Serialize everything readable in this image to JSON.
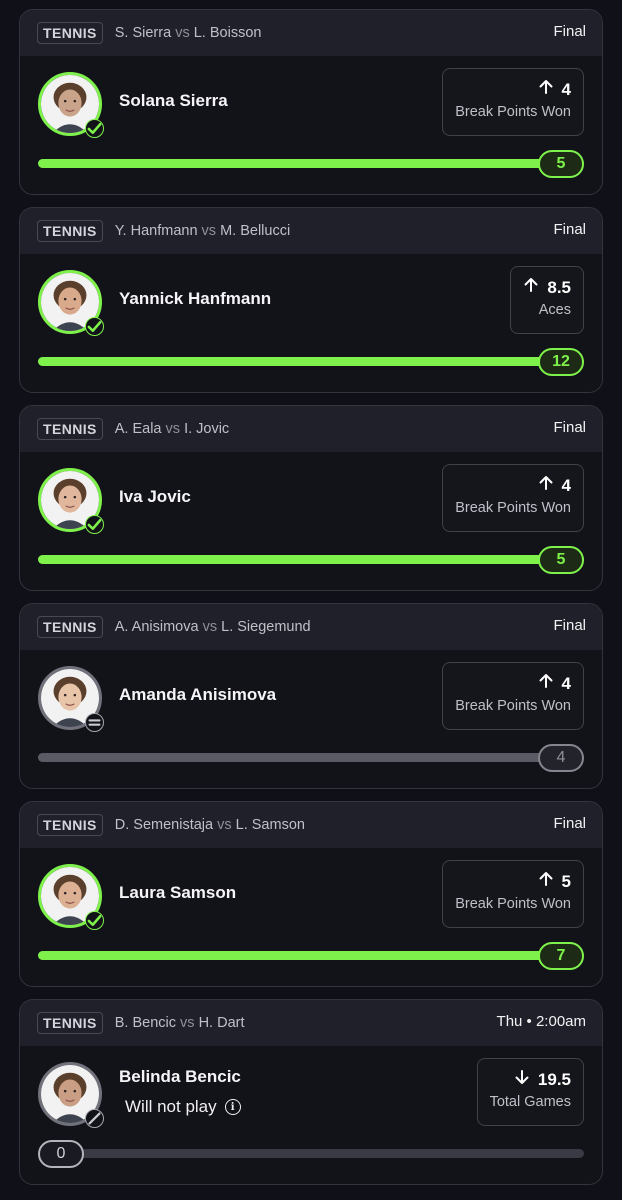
{
  "colors": {
    "background": "#101018",
    "card": "#121219",
    "card_header": "#1f2029",
    "accent_green": "#7ef14a",
    "neutral_grey": "#5a5b65",
    "text_muted": "#bfc0c8"
  },
  "cards": [
    {
      "sport": "TENNIS",
      "player_a": "S. Sierra",
      "vs": "vs",
      "player_b": "L. Boisson",
      "status": "Final",
      "name": "Solana Sierra",
      "subtext": "",
      "direction": "up",
      "direction_icon": "arrow-up-icon",
      "line": "4",
      "stat": "Break Points Won",
      "result": "5",
      "progress": 1.0,
      "state": "won",
      "badge_icon": "check-icon",
      "avatar_tone": "#c9a48a"
    },
    {
      "sport": "TENNIS",
      "player_a": "Y. Hanfmann",
      "vs": "vs",
      "player_b": "M. Bellucci",
      "status": "Final",
      "name": "Yannick Hanfmann",
      "subtext": "",
      "direction": "up",
      "direction_icon": "arrow-up-icon",
      "line": "8.5",
      "stat": "Aces",
      "result": "12",
      "progress": 1.0,
      "state": "won",
      "badge_icon": "check-icon",
      "avatar_tone": "#d9a98c"
    },
    {
      "sport": "TENNIS",
      "player_a": "A. Eala",
      "vs": "vs",
      "player_b": "I. Jovic",
      "status": "Final",
      "name": "Iva Jovic",
      "subtext": "",
      "direction": "up",
      "direction_icon": "arrow-up-icon",
      "line": "4",
      "stat": "Break Points Won",
      "result": "5",
      "progress": 1.0,
      "state": "won",
      "badge_icon": "check-icon",
      "avatar_tone": "#e0b79d"
    },
    {
      "sport": "TENNIS",
      "player_a": "A. Anisimova",
      "vs": "vs",
      "player_b": "L. Siegemund",
      "status": "Final",
      "name": "Amanda Anisimova",
      "subtext": "",
      "direction": "up",
      "direction_icon": "arrow-up-icon",
      "line": "4",
      "stat": "Break Points Won",
      "result": "4",
      "progress": 1.0,
      "state": "push",
      "badge_icon": "equals-icon",
      "avatar_tone": "#e8c4a8"
    },
    {
      "sport": "TENNIS",
      "player_a": "D. Semenistaja",
      "vs": "vs",
      "player_b": "L. Samson",
      "status": "Final",
      "name": "Laura Samson",
      "subtext": "",
      "direction": "up",
      "direction_icon": "arrow-up-icon",
      "line": "5",
      "stat": "Break Points Won",
      "result": "7",
      "progress": 1.0,
      "state": "won",
      "badge_icon": "check-icon",
      "avatar_tone": "#dcb092"
    },
    {
      "sport": "TENNIS",
      "player_a": "B. Bencic",
      "vs": "vs",
      "player_b": "H. Dart",
      "status": "Thu • 2:00am",
      "name": "Belinda Bencic",
      "subtext": "Will not play",
      "direction": "down",
      "direction_icon": "arrow-down-icon",
      "line": "19.5",
      "stat": "Total Games",
      "result": "0",
      "progress": 0.0,
      "state": "void",
      "badge_icon": "slash-icon",
      "avatar_tone": "#c99e84"
    }
  ]
}
